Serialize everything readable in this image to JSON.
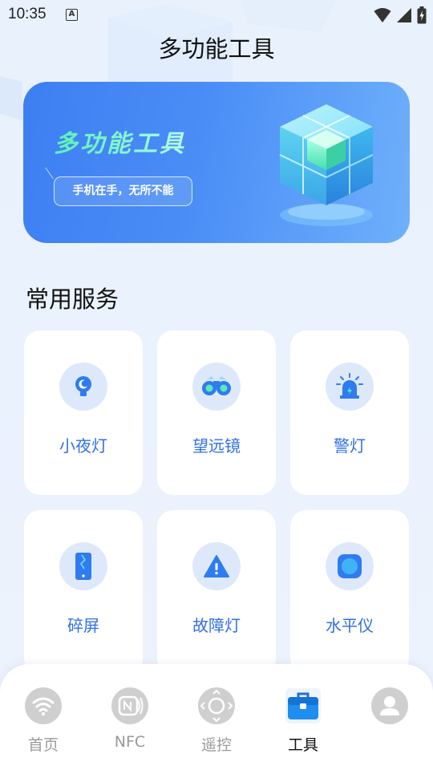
{
  "status_bar": {
    "time": "10:35",
    "notification_icon": "a-icon",
    "icons": [
      "wifi-icon",
      "signal-icon",
      "battery-icon"
    ]
  },
  "page_title": "多功能工具",
  "banner": {
    "title": "多功能工具",
    "tagline": "手机在手，无所不能",
    "illustration": "cube-icon"
  },
  "section_title": "常用服务",
  "services": [
    {
      "label": "小夜灯",
      "icon": "night-light-icon"
    },
    {
      "label": "望远镜",
      "icon": "binoculars-icon"
    },
    {
      "label": "警灯",
      "icon": "alarm-light-icon"
    },
    {
      "label": "碎屏",
      "icon": "broken-screen-icon"
    },
    {
      "label": "故障灯",
      "icon": "warning-triangle-icon"
    },
    {
      "label": "水平仪",
      "icon": "level-icon"
    }
  ],
  "nav": {
    "items": [
      {
        "label": "首页",
        "icon": "wifi-icon",
        "active": false
      },
      {
        "label": "NFC",
        "icon": "nfc-icon",
        "active": false
      },
      {
        "label": "遥控",
        "icon": "remote-dpad-icon",
        "active": false
      },
      {
        "label": "工具",
        "icon": "toolbox-icon",
        "active": true
      },
      {
        "label": "",
        "icon": "user-icon",
        "active": false
      }
    ]
  },
  "colors": {
    "accent": "#2f6fe6",
    "icon_bg": "#dde9fb",
    "banner_start": "#3d7ff2",
    "banner_end": "#6fb0fb",
    "banner_title": "#5cf2b5",
    "nav_inactive": "#cccccc",
    "nav_active": "#1f8ef0"
  }
}
